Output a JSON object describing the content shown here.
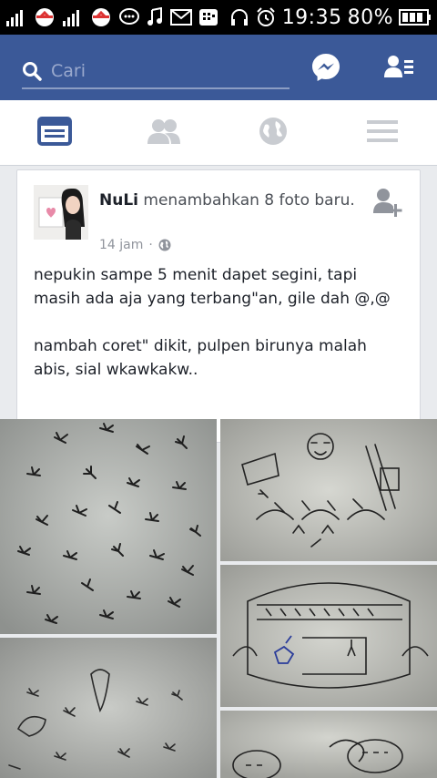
{
  "status_bar": {
    "time": "19:35",
    "battery": "80%",
    "left_icons": [
      "signal-icon",
      "data-icon",
      "signal-icon",
      "data-icon",
      "chat-icon",
      "music-icon",
      "gmail-icon",
      "bbm-icon"
    ],
    "right_icons": [
      "headset-icon",
      "alarm-icon",
      "battery-icon"
    ]
  },
  "header": {
    "search_placeholder": "Cari",
    "icons": [
      "search-icon",
      "messenger-icon",
      "friend-requests-icon"
    ],
    "color": "#3b5998"
  },
  "nav": {
    "tabs": [
      {
        "name": "news-feed",
        "icon": "news-feed-icon",
        "active": true
      },
      {
        "name": "friends",
        "icon": "friends-icon",
        "active": false
      },
      {
        "name": "notifications",
        "icon": "globe-icon",
        "active": false
      },
      {
        "name": "menu",
        "icon": "menu-icon",
        "active": false
      }
    ],
    "active_color": "#3b5998",
    "inactive_color": "#c9ccd1"
  },
  "post": {
    "author": "NuLi",
    "action": "menambahkan 8 foto baru.",
    "time": "14 jam",
    "separator": "·",
    "privacy_icon": "globe-icon",
    "text_paragraph_1": "nepukin sampe 5 menit dapet segini, tapi masih ada aja yang terbang\"an, gile dah @,@",
    "text_paragraph_2": "nambah coret\" dikit, pulpen birunya malah abis, sial wkawkakw.."
  },
  "photos": [
    {
      "name": "photo-mosquitoes-1"
    },
    {
      "name": "photo-drawing-1"
    },
    {
      "name": "photo-drawing-2"
    },
    {
      "name": "photo-mosquitoes-2"
    },
    {
      "name": "photo-drawing-3"
    }
  ]
}
